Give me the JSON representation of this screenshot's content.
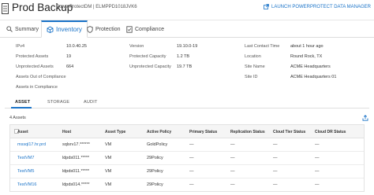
{
  "header": {
    "title": "Prod Backup",
    "subtitle": "PowerProtectDM | ELMPPD1018JVK6",
    "launch_label": "LAUNCH POWERPROTECT DATA MANAGER"
  },
  "tabs": [
    {
      "label": "Summary",
      "icon": "magnifier-icon"
    },
    {
      "label": "Inventory",
      "icon": "inventory-icon"
    },
    {
      "label": "Protection",
      "icon": "shield-icon"
    },
    {
      "label": "Compliance",
      "icon": "compliance-icon"
    }
  ],
  "summary": {
    "col1": [
      {
        "key": "IPv4",
        "value": "10.0.40.25"
      },
      {
        "key": "Protected Assets",
        "value": "19"
      },
      {
        "key": "Unprotected Assets",
        "value": "664"
      },
      {
        "key": "Assets Out of Compliance",
        "value": ""
      },
      {
        "key": "Assets in Compliance",
        "value": ""
      }
    ],
    "col2": [
      {
        "key": "Version",
        "value": "19.10.0-19"
      },
      {
        "key": "Protected Capacity",
        "value": "1.2 TB"
      },
      {
        "key": "Unprotected Capacity",
        "value": "19.7 TB"
      }
    ],
    "col3": [
      {
        "key": "Last Contact Time",
        "value": "about 1 hour ago"
      },
      {
        "key": "Location",
        "value": "Round Rock, TX"
      },
      {
        "key": "Site Name",
        "value": "ACME Headquarters"
      },
      {
        "key": "Site ID",
        "value": "ACME Headquarters 01"
      }
    ]
  },
  "subtabs": [
    "ASSET",
    "STORAGE",
    "AUDIT"
  ],
  "asset_count": "4 Assets",
  "table": {
    "headers": [
      "Asset",
      "Host",
      "Asset Type",
      "Active Policy",
      "Primary Status",
      "Replication Status",
      "Cloud Tier Status",
      "Cloud DR Status"
    ],
    "rows": [
      [
        "mssql17.hr.prd",
        "sqlsrv17.******",
        "VM",
        "GoldPolicy",
        "—",
        "—",
        "—",
        "—"
      ],
      [
        "TestVM7",
        "ldpds011.*****",
        "VM",
        "29Policy",
        "—",
        "—",
        "—",
        "—"
      ],
      [
        "TestVM5",
        "ldpds011.*****",
        "VM",
        "29Policy",
        "—",
        "—",
        "—",
        "—"
      ],
      [
        "TestVM16",
        "ldpds014.*****",
        "VM",
        "29Policy",
        "—",
        "—",
        "—",
        "—"
      ]
    ]
  },
  "colors": {
    "accent": "#1a73c8"
  }
}
